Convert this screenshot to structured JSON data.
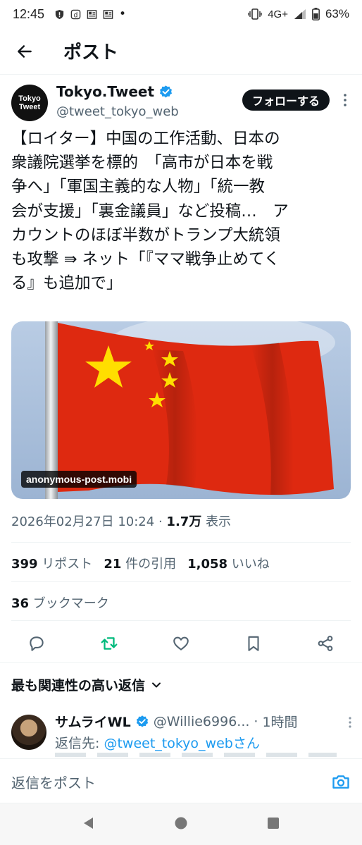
{
  "status_bar": {
    "time": "12:45",
    "network": "4G+",
    "battery_percent": "63%",
    "dot": "•",
    "icons": [
      "shield-alert-icon",
      "d-app-icon",
      "news-icon",
      "news-icon",
      "vibrate-icon",
      "signal-icon",
      "battery-icon"
    ]
  },
  "app_bar": {
    "title": "ポスト",
    "back_icon": "arrow-left-icon"
  },
  "author": {
    "avatar_line1": "Tokyo",
    "avatar_line2": "Tweet",
    "name": "Tokyo.Tweet",
    "handle": "@tweet_tokyo_web",
    "verified_icon": "verified-badge-icon",
    "follow_label": "フォローする",
    "more_icon": "more-vertical-icon"
  },
  "tweet": {
    "lines": [
      "【ロイター】中国の工作活動、日本の",
      "衆議院選挙を標的　「高市が日本を戦",
      "争へ」「軍国主義的な人物」「統一教",
      "会が支援」「裏金議員」など投稿…　ア",
      "カウントのほぼ半数がトランプ大統領",
      "も攻撃 ⇛ ネット「『ママ戦争止めてく",
      "る』も追加で」"
    ],
    "media_source": "anonymous-post.mobi",
    "timestamp": "2026年02月27日 10:24",
    "separator": "·",
    "views_count": "1.7万",
    "views_label": "表示"
  },
  "stats": {
    "reposts_count": "399",
    "reposts_label": "リポスト",
    "quotes_count": "21",
    "quotes_label": "件の引用",
    "likes_count": "1,058",
    "likes_label": "いいね",
    "bookmarks_count": "36",
    "bookmarks_label": "ブックマーク"
  },
  "actions": [
    "reply-icon",
    "repost-icon",
    "like-icon",
    "bookmark-icon",
    "share-icon"
  ],
  "colors": {
    "repost_active": "#00ba7c",
    "link": "#1d9bf0",
    "muted": "#536471",
    "text": "#0f1419",
    "flag_red": "#de2910",
    "flag_yellow": "#ffde00"
  },
  "replies_sort": {
    "label": "最も関連性の高い返信",
    "chevron_icon": "chevron-down-icon"
  },
  "reply": {
    "name": "サムライWL",
    "handle": "@Willie6996...",
    "time_sep": "·",
    "time": "1時間",
    "reply_to_label": "返信先:",
    "reply_to_handle": "@tweet_tokyo_webさん"
  },
  "composer": {
    "placeholder": "返信をポスト",
    "camera_icon": "camera-icon"
  },
  "nav": [
    "back-triangle-icon",
    "home-circle-icon",
    "recents-square-icon"
  ]
}
